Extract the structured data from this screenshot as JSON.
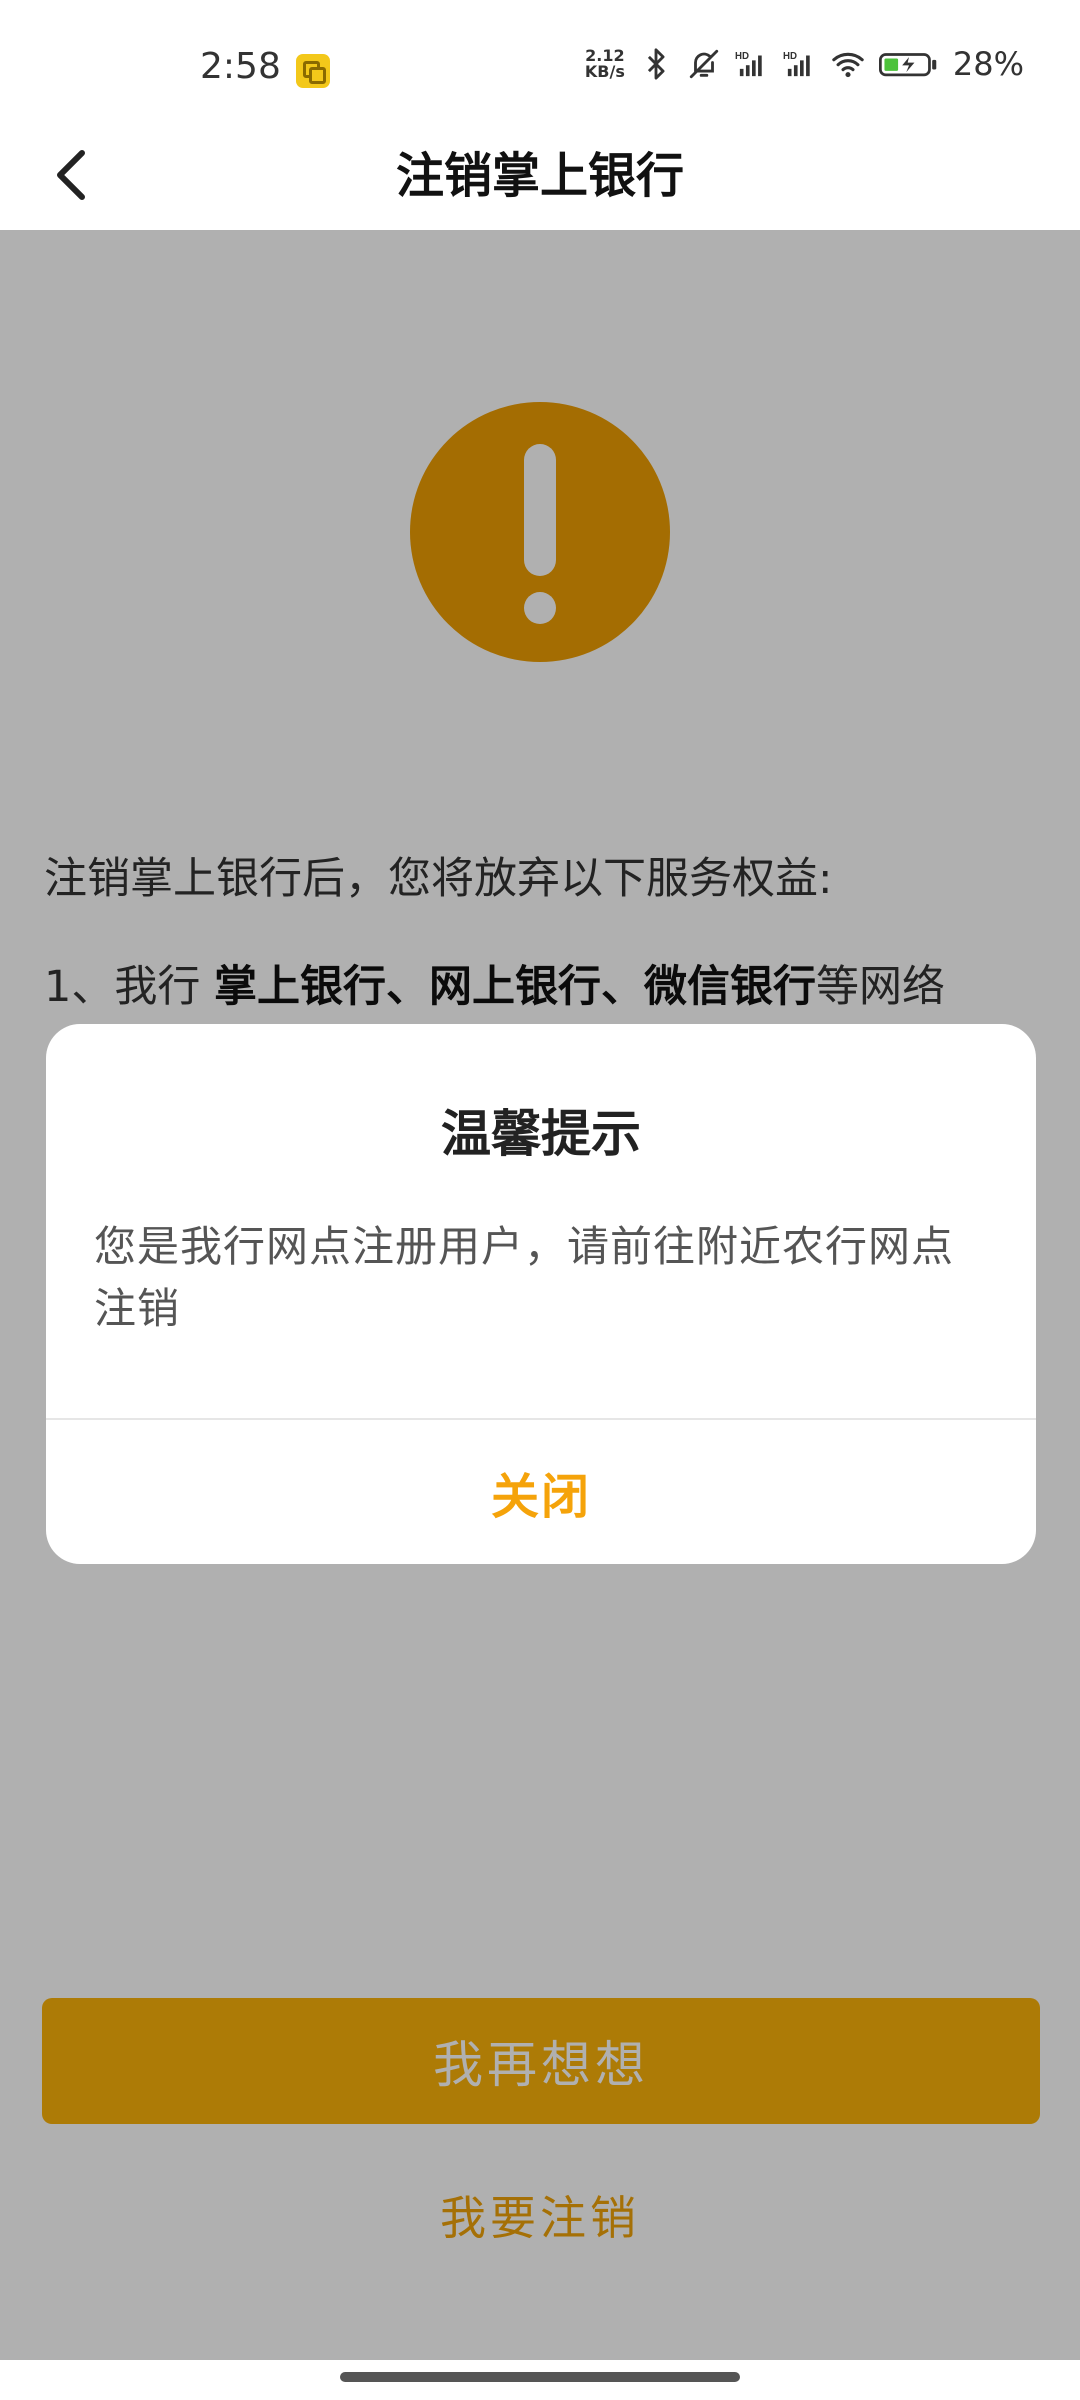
{
  "status_bar": {
    "time": "2:58",
    "net_speed_top": "2.12",
    "net_speed_bottom": "KB/s",
    "battery": "28%",
    "icons": [
      "app-notification-icon",
      "bluetooth-icon",
      "mute-bell-icon",
      "hd-signal-icon",
      "hd-signal-icon",
      "wifi-icon",
      "battery-charging-icon"
    ]
  },
  "nav": {
    "title": "注销掌上银行",
    "back_icon": "chevron-left-icon"
  },
  "page": {
    "alert_icon": "exclamation-icon",
    "intro": "注销掌上银行后，您将放弃以下服务权益:",
    "item1_prefix": "1、我行 ",
    "item1_bold": "掌上银行、网上银行、微信银行",
    "item1_suffix": "等网络",
    "primary_button": "我再想想",
    "secondary_link": "我要注销"
  },
  "dialog": {
    "title": "温馨提示",
    "message": "您是我行网点注册用户，请前往附近农行网点注销",
    "close_button": "关闭"
  },
  "colors": {
    "accent": "#f5a30a",
    "button": "#fbb20a",
    "overlay": "rgba(0,0,0,0.31)"
  }
}
